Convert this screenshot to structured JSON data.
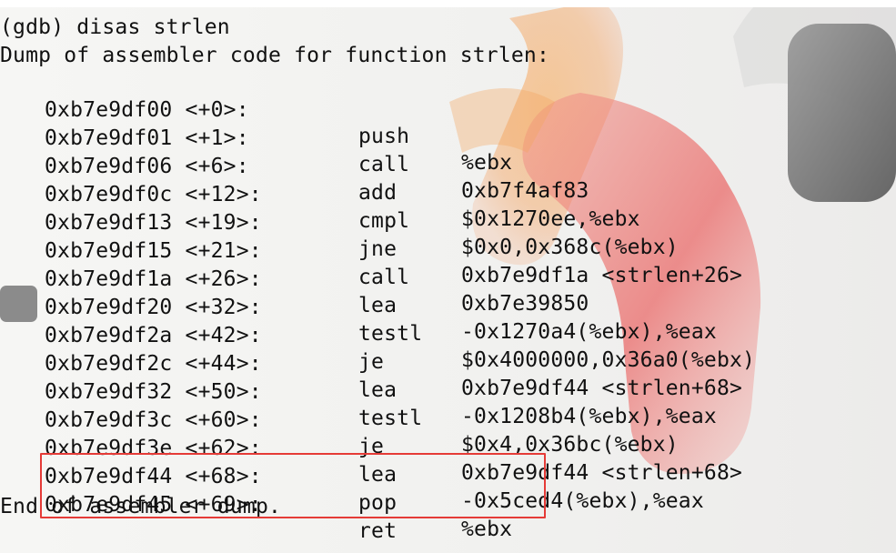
{
  "terminal": {
    "command_line": "(gdb) disas strlen",
    "dump_header": "Dump of assembler code for function strlen:",
    "rows": [
      {
        "address": "0xb7e9df00 <+0>:",
        "mnemonic": "push",
        "operands": "%ebx"
      },
      {
        "address": "0xb7e9df01 <+1>:",
        "mnemonic": "call",
        "operands": "0xb7f4af83"
      },
      {
        "address": "0xb7e9df06 <+6>:",
        "mnemonic": "add",
        "operands": "$0x1270ee,%ebx"
      },
      {
        "address": "0xb7e9df0c <+12>:",
        "mnemonic": "cmpl",
        "operands": "$0x0,0x368c(%ebx)"
      },
      {
        "address": "0xb7e9df13 <+19>:",
        "mnemonic": "jne",
        "operands": "0xb7e9df1a <strlen+26>"
      },
      {
        "address": "0xb7e9df15 <+21>:",
        "mnemonic": "call",
        "operands": "0xb7e39850"
      },
      {
        "address": "0xb7e9df1a <+26>:",
        "mnemonic": "lea",
        "operands": "-0x1270a4(%ebx),%eax"
      },
      {
        "address": "0xb7e9df20 <+32>:",
        "mnemonic": "testl",
        "operands": "$0x4000000,0x36a0(%ebx)"
      },
      {
        "address": "0xb7e9df2a <+42>:",
        "mnemonic": "je",
        "operands": "0xb7e9df44 <strlen+68>"
      },
      {
        "address": "0xb7e9df2c <+44>:",
        "mnemonic": "lea",
        "operands": "-0x1208b4(%ebx),%eax"
      },
      {
        "address": "0xb7e9df32 <+50>:",
        "mnemonic": "testl",
        "operands": "$0x4,0x36bc(%ebx)"
      },
      {
        "address": "0xb7e9df3c <+60>:",
        "mnemonic": "je",
        "operands": "0xb7e9df44 <strlen+68>"
      },
      {
        "address": "0xb7e9df3e <+62>:",
        "mnemonic": "lea",
        "operands": "-0x5ced4(%ebx),%eax"
      },
      {
        "address": "0xb7e9df44 <+68>:",
        "mnemonic": "pop",
        "operands": "%ebx"
      },
      {
        "address": "0xb7e9df45 <+69>:",
        "mnemonic": "ret",
        "operands": ""
      }
    ],
    "footer": "End of assembler dump.",
    "colors": {
      "text": "#111111",
      "highlight_box": "#e53b37",
      "background": "#f3f3f1"
    }
  }
}
